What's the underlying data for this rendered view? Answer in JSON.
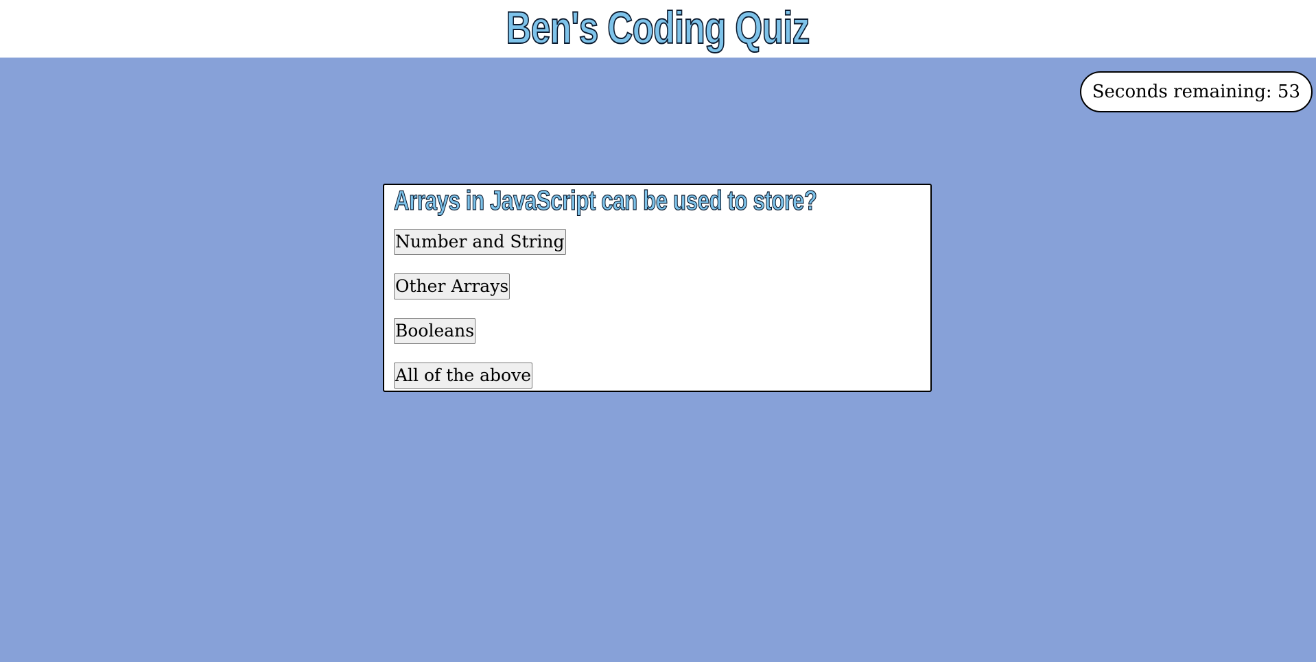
{
  "header": {
    "title": "Ben's Coding Quiz"
  },
  "timer": {
    "label": "Seconds remaining:",
    "seconds": "53"
  },
  "quiz": {
    "question": "Arrays in JavaScript can be used to store?",
    "answers": [
      "Number and String",
      "Other Arrays",
      "Booleans",
      "All of the above"
    ]
  },
  "colors": {
    "page_background": "#87a1d8",
    "title_fill": "#7ec3ea",
    "title_outline": "#0b1a2e",
    "card_background": "#ffffff",
    "button_background": "#efefef"
  }
}
